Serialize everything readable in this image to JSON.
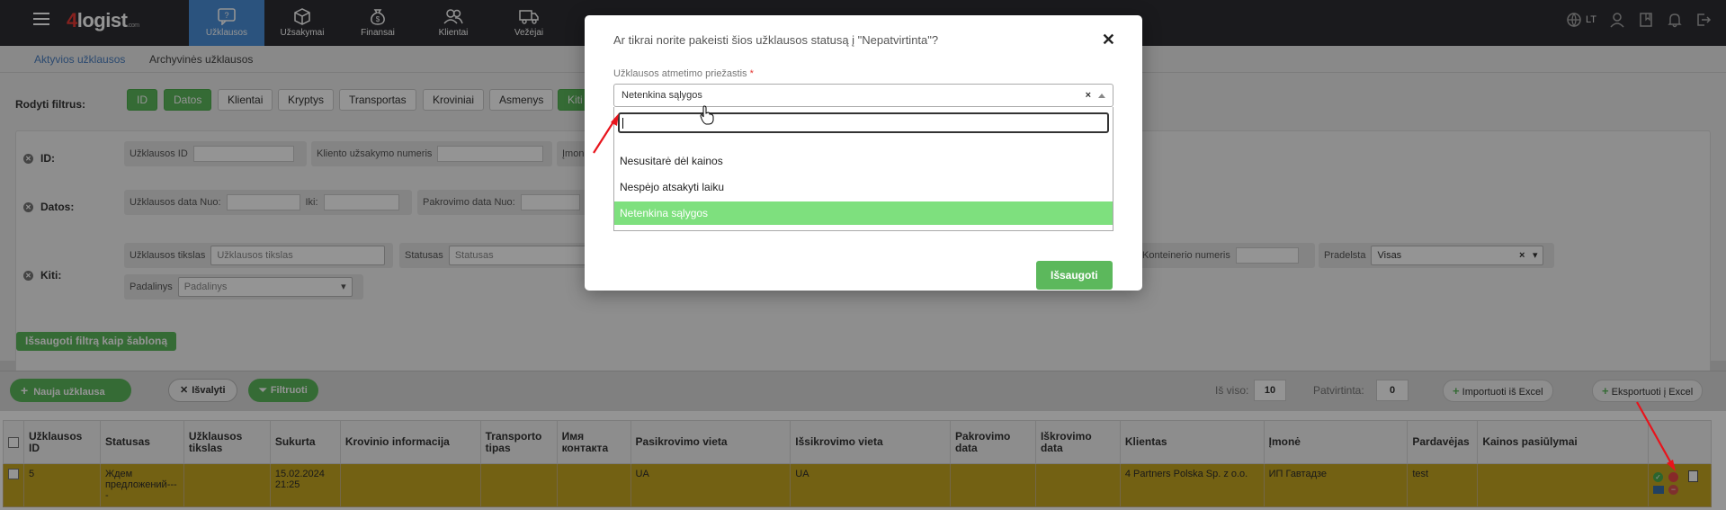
{
  "app": {
    "logo_main": "logist",
    "logo_digit": "4",
    "logo_suffix": ".com",
    "language": "LT"
  },
  "nav": {
    "items": [
      {
        "label": "Užklausos",
        "icon": "chat-question-icon"
      },
      {
        "label": "Užsakymai",
        "icon": "box-icon"
      },
      {
        "label": "Finansai",
        "icon": "money-bag-icon"
      },
      {
        "label": "Klientai",
        "icon": "users-icon"
      },
      {
        "label": "Vežėjai",
        "icon": "truck-icon"
      }
    ]
  },
  "subnav": {
    "active": "Aktyvios užklausos",
    "archive": "Archyvinės užklausos"
  },
  "filters": {
    "label": "Rodyti filtrus:",
    "chips": [
      "ID",
      "Datos",
      "Klientai",
      "Kryptys",
      "Transportas",
      "Kroviniai",
      "Asmenys",
      "Kiti"
    ],
    "rows": {
      "id": "ID:",
      "datos": "Datos:",
      "kiti": "Kiti:"
    },
    "fields": {
      "uzklausos_id": "Užklausos ID",
      "kliento_nr": "Kliento užsakymo numeris",
      "imone": "Įmon",
      "data_nuo": "Užklausos data Nuo:",
      "iki": "Iki:",
      "pakrovimo_nuo": "Pakrovimo data Nuo:",
      "tikslas_label": "Užklausos tikslas",
      "tikslas_placeholder": "Užklausos tikslas",
      "statusas_label": "Statusas",
      "statusas_placeholder": "Statusas",
      "konteinerio": "Konteinerio numeris",
      "pradelsta_label": "Pradelsta",
      "pradelsta_value": "Visas",
      "padalinys_label": "Padalinys",
      "padalinys_placeholder": "Padalinys"
    },
    "save_template": "Išsaugoti filtrą kaip šabloną"
  },
  "toolbar": {
    "new": "Nauja užklausa",
    "clear": "Išvalyti",
    "filter": "Filtruoti",
    "total_label": "Iš viso:",
    "total_value": "10",
    "confirmed_label": "Patvirtinta:",
    "confirmed_value": "0",
    "import": "Importuoti iš Excel",
    "export": "Eksportuoti į Excel"
  },
  "table": {
    "headers": [
      "Užklausos ID",
      "Statusas",
      "Užklausos tikslas",
      "Sukurta",
      "Krovinio informacija",
      "Transporto tipas",
      "Имя контакта",
      "Pasikrovimo vieta",
      "Išsikrovimo vieta",
      "Pakrovimo data",
      "Iškrovimo data",
      "Klientas",
      "Įmonė",
      "Pardavėjas",
      "Kainos pasiūlymai"
    ],
    "rows": [
      {
        "id": "5",
        "statusas": "Ждем предложений----",
        "tikslas": "",
        "sukurta": "15.02.2024 21:25",
        "krovinys": "",
        "transportas": "",
        "kontaktas": "",
        "pasikrovimas": "UA",
        "issikrovimas": "UA",
        "pakrovimo_data": "",
        "iskrovimo_data": "",
        "klientas": "4 Partners Polska Sp. z o.o.",
        "imone": "ИП Гавтадзе",
        "pardavejas": "test",
        "kainos": ""
      }
    ]
  },
  "modal": {
    "title": "Ar tikrai norite pakeisti šios užklausos statusą į \"Nepatvirtinta\"?",
    "reason_label": "Užklausos atmetimo priežastis",
    "required_mark": "*",
    "selected": "Netenkina sąlygos",
    "clear_symbol": "×",
    "close_symbol": "✕",
    "options": [
      "Nesusitarė dėl kainos",
      "Nespėjo atsakyti laiku",
      "Netenkina sąlygos"
    ],
    "save": "Išsaugoti"
  },
  "colors": {
    "nav_bg": "#2e2e33",
    "nav_active": "#4a90d9",
    "green": "#5cb85c",
    "row_highlight": "#c7a821",
    "option_selected": "#7ee07e",
    "annotation_arrow": "#e8141c"
  }
}
